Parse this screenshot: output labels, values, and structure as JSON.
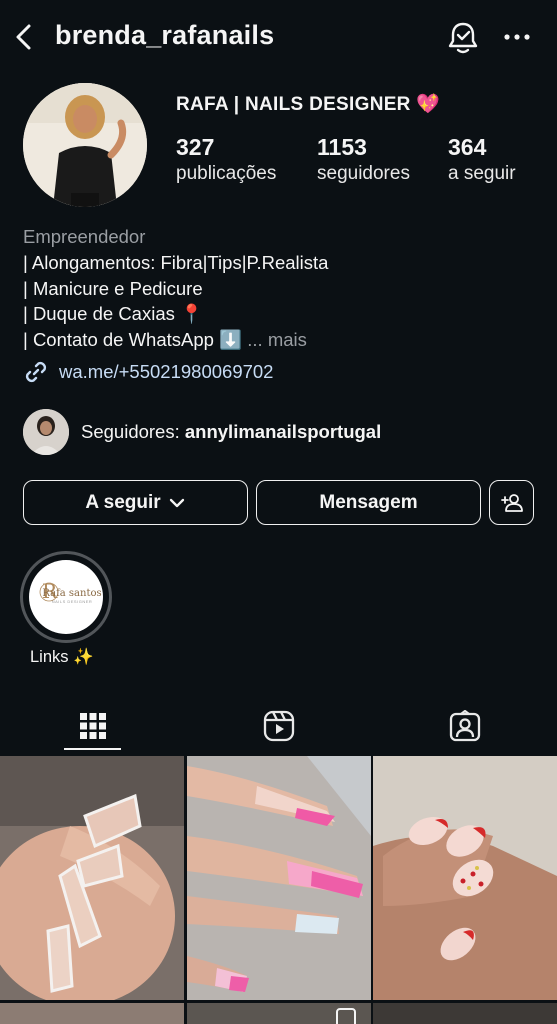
{
  "header": {
    "username": "brenda_rafanails",
    "back_icon": "chevron-left-icon",
    "notification_icon": "bell-check-icon",
    "more_icon": "more-horizontal-icon"
  },
  "profile": {
    "display_name": "RAFA | NAILS DESIGNER 💖",
    "stats": [
      {
        "value": "327",
        "label": "publicações"
      },
      {
        "value": "1153",
        "label": "seguidores"
      },
      {
        "value": "364",
        "label": "a seguir"
      }
    ]
  },
  "bio": {
    "category": "Empreendedor",
    "lines": [
      "| Alongamentos: Fibra|Tips|P.Realista",
      "| Manicure e Pedicure",
      "| Duque de Caxias 📍",
      "| Contato de WhatsApp ⬇️"
    ],
    "more_label": "... mais",
    "link": "wa.me/+55021980069702"
  },
  "followed_by": {
    "prefix": "Seguidores: ",
    "name": "annylimanailsportugal"
  },
  "actions": {
    "following_label": "A seguir",
    "message_label": "Mensagem",
    "add_person_icon": "add-person-icon"
  },
  "highlights": [
    {
      "label": "Links ✨",
      "cover_text": "Rafa santos",
      "cover_subtext": "NAILS DESIGNER"
    }
  ],
  "tabs": [
    {
      "name": "grid-icon",
      "active": true
    },
    {
      "name": "reels-icon",
      "active": false
    },
    {
      "name": "tagged-icon",
      "active": false
    }
  ],
  "colors": {
    "background": "#0b1014",
    "link": "#c7dcf5",
    "secondary_text": "#9a9ea3"
  }
}
